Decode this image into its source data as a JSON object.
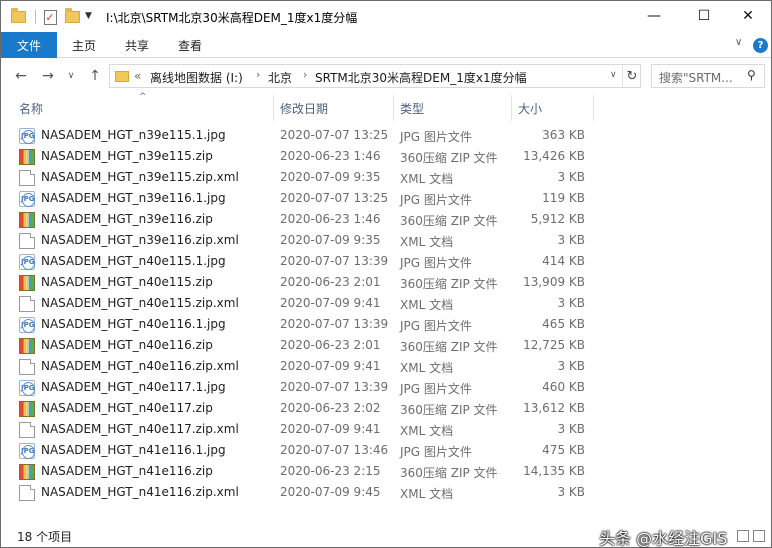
{
  "titlebar": {
    "path": "I:\\北京\\SRTM北京30米高程DEM_1度x1度分幅",
    "minimize": "—",
    "maximize": "☐",
    "close": "✕"
  },
  "ribbon": {
    "file": "文件",
    "home": "主页",
    "share": "共享",
    "view": "查看",
    "expand": "∨"
  },
  "address": {
    "overflow": "«",
    "crumbs": [
      "离线地图数据 (I:)",
      "北京",
      "SRTM北京30米高程DEM_1度x1度分幅"
    ],
    "separator": "›",
    "search_placeholder": "搜索\"SRTM...",
    "search_icon": "magnifier-icon",
    "refresh_icon": "refresh-icon"
  },
  "columns": {
    "name": "名称",
    "date": "修改日期",
    "type": "类型",
    "size": "大小"
  },
  "files": [
    {
      "name": "NASADEM_HGT_n39e115.1.jpg",
      "date": "2020-07-07 13:25",
      "type": "JPG 图片文件",
      "size": "363 KB",
      "kind": "jpg"
    },
    {
      "name": "NASADEM_HGT_n39e115.zip",
      "date": "2020-06-23 1:46",
      "type": "360压缩 ZIP 文件",
      "size": "13,426 KB",
      "kind": "zip"
    },
    {
      "name": "NASADEM_HGT_n39e115.zip.xml",
      "date": "2020-07-09 9:35",
      "type": "XML 文档",
      "size": "3 KB",
      "kind": "xml"
    },
    {
      "name": "NASADEM_HGT_n39e116.1.jpg",
      "date": "2020-07-07 13:25",
      "type": "JPG 图片文件",
      "size": "119 KB",
      "kind": "jpg"
    },
    {
      "name": "NASADEM_HGT_n39e116.zip",
      "date": "2020-06-23 1:46",
      "type": "360压缩 ZIP 文件",
      "size": "5,912 KB",
      "kind": "zip"
    },
    {
      "name": "NASADEM_HGT_n39e116.zip.xml",
      "date": "2020-07-09 9:35",
      "type": "XML 文档",
      "size": "3 KB",
      "kind": "xml"
    },
    {
      "name": "NASADEM_HGT_n40e115.1.jpg",
      "date": "2020-07-07 13:39",
      "type": "JPG 图片文件",
      "size": "414 KB",
      "kind": "jpg"
    },
    {
      "name": "NASADEM_HGT_n40e115.zip",
      "date": "2020-06-23 2:01",
      "type": "360压缩 ZIP 文件",
      "size": "13,909 KB",
      "kind": "zip"
    },
    {
      "name": "NASADEM_HGT_n40e115.zip.xml",
      "date": "2020-07-09 9:41",
      "type": "XML 文档",
      "size": "3 KB",
      "kind": "xml"
    },
    {
      "name": "NASADEM_HGT_n40e116.1.jpg",
      "date": "2020-07-07 13:39",
      "type": "JPG 图片文件",
      "size": "465 KB",
      "kind": "jpg"
    },
    {
      "name": "NASADEM_HGT_n40e116.zip",
      "date": "2020-06-23 2:01",
      "type": "360压缩 ZIP 文件",
      "size": "12,725 KB",
      "kind": "zip"
    },
    {
      "name": "NASADEM_HGT_n40e116.zip.xml",
      "date": "2020-07-09 9:41",
      "type": "XML 文档",
      "size": "3 KB",
      "kind": "xml"
    },
    {
      "name": "NASADEM_HGT_n40e117.1.jpg",
      "date": "2020-07-07 13:39",
      "type": "JPG 图片文件",
      "size": "460 KB",
      "kind": "jpg"
    },
    {
      "name": "NASADEM_HGT_n40e117.zip",
      "date": "2020-06-23 2:02",
      "type": "360压缩 ZIP 文件",
      "size": "13,612 KB",
      "kind": "zip"
    },
    {
      "name": "NASADEM_HGT_n40e117.zip.xml",
      "date": "2020-07-09 9:41",
      "type": "XML 文档",
      "size": "3 KB",
      "kind": "xml"
    },
    {
      "name": "NASADEM_HGT_n41e116.1.jpg",
      "date": "2020-07-07 13:46",
      "type": "JPG 图片文件",
      "size": "475 KB",
      "kind": "jpg"
    },
    {
      "name": "NASADEM_HGT_n41e116.zip",
      "date": "2020-06-23 2:15",
      "type": "360压缩 ZIP 文件",
      "size": "14,135 KB",
      "kind": "zip"
    },
    {
      "name": "NASADEM_HGT_n41e116.zip.xml",
      "date": "2020-07-09 9:45",
      "type": "XML 文档",
      "size": "3 KB",
      "kind": "xml"
    }
  ],
  "status": {
    "count": "18 个项目",
    "watermark": "头条 @水经注GIS"
  },
  "colors": {
    "accent": "#1979ca",
    "header_text": "#4d6082",
    "meta_text": "#6d6d6d"
  }
}
